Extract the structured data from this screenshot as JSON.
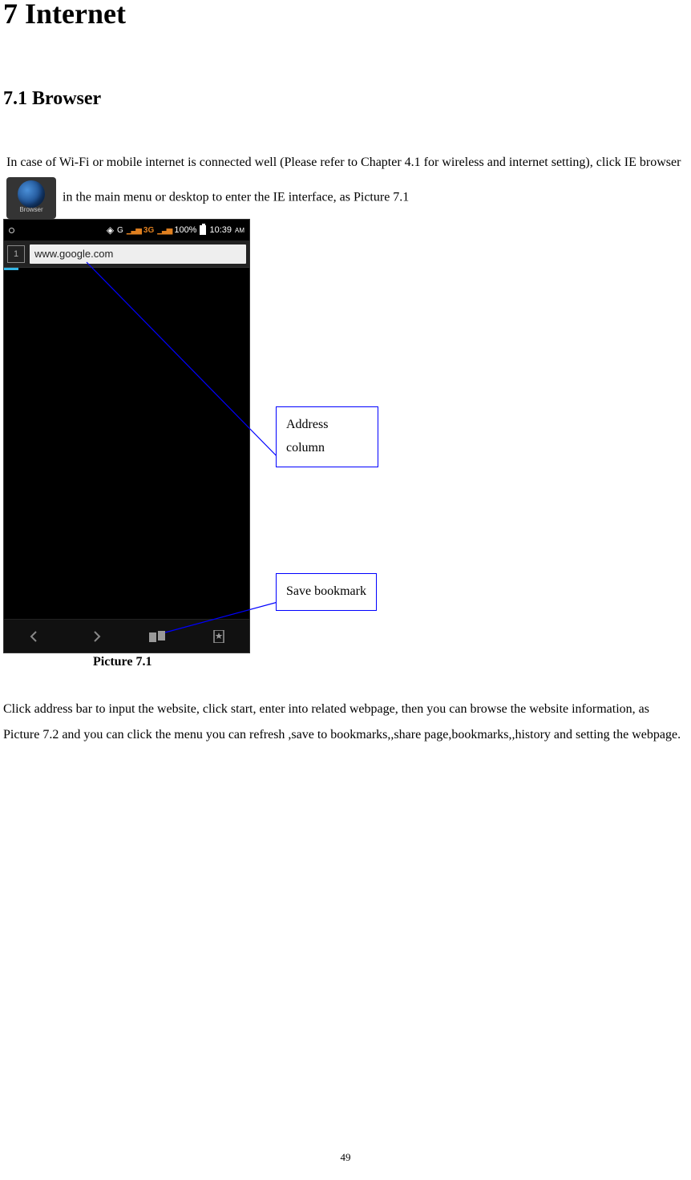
{
  "heading": "7 Internet",
  "subheading": "7.1 Browser",
  "intro_text_1": "In case of Wi-Fi or mobile internet is connected well (Please refer to Chapter 4.1 for wireless and internet setting), click IE browser ",
  "intro_text_2": " in the main menu or desktop to enter the IE interface, as Picture 7.1",
  "browser_icon_label": "Browser",
  "phone": {
    "status": {
      "network": "3G",
      "battery_pct": "100%",
      "time": "10:39",
      "ampm": "AM"
    },
    "address_url": "www.google.com"
  },
  "callouts": {
    "address": "Address column",
    "save_bookmark": "Save bookmark"
  },
  "figure_caption": "Picture 7.1",
  "para2": "Click address bar to input the website, click start, enter into related webpage, then you can browse the website information, as Picture 7.2 and you can click the menu you can refresh ,save to bookmarks,,share page,bookmarks,,history and setting the webpage.",
  "page_number": "49"
}
